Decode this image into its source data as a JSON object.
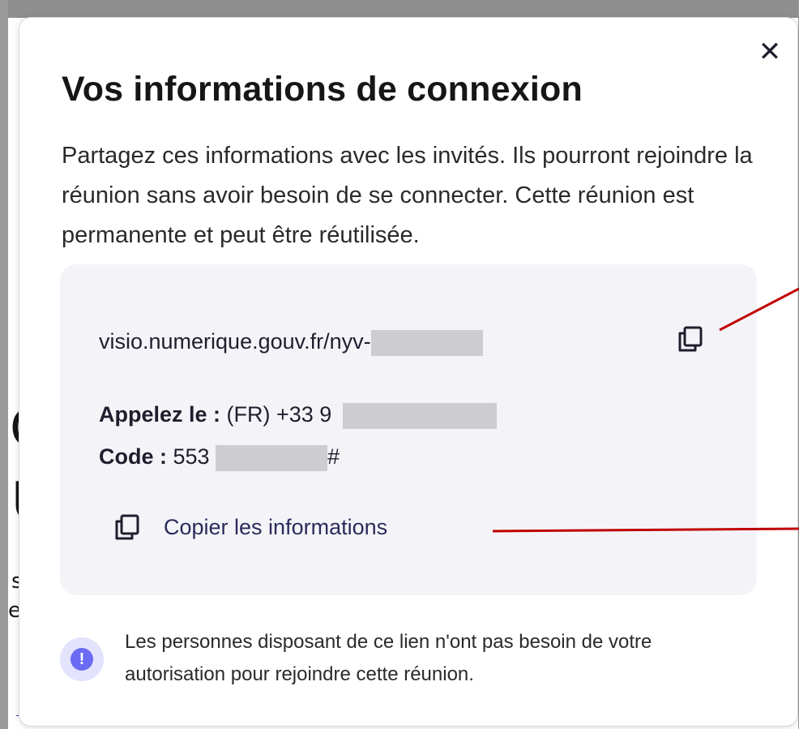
{
  "background_page": {
    "glyphs": [
      "C",
      "U",
      "s",
      "et"
    ]
  },
  "dialog": {
    "close_symbol": "✕",
    "title": "Vos informations de connexion",
    "description": "Partagez ces informations avec les invités. Ils pourront rejoindre la réunion sans avoir besoin de se connecter. Cette réunion est permanente et peut être réutilisée.",
    "info_card": {
      "link_text": "visio.numerique.gouv.fr/nyv-",
      "phone_label": "Appelez le :",
      "phone_value": " (FR) +33 9",
      "code_label": "Code :",
      "code_value": " 553",
      "code_suffix": "#",
      "copy_info_label": "Copier les informations"
    },
    "warning": {
      "icon_symbol": "!",
      "text": "Les personnes disposant de ce lien n'ont pas besoin de votre autorisation pour rejoindre cette réunion."
    }
  },
  "colors": {
    "annotation_red": "#c00000",
    "card_background": "#f4f4f8",
    "accent": "#6a6af4",
    "redaction": "#cdcdd0"
  },
  "icons": {
    "close": "close-icon",
    "copy_link": "copy-icon",
    "copy_info": "copy-icon",
    "warning": "exclamation-icon"
  }
}
